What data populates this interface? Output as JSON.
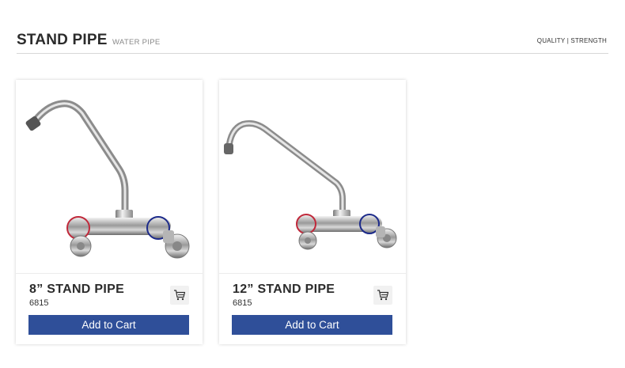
{
  "section": {
    "title": "STAND PIPE",
    "subtitle": "WATER PIPE",
    "tagline": "QUALITY | STRENGTH"
  },
  "products": [
    {
      "name": "8” STAND PIPE",
      "code": "6815",
      "add_label": "Add to Cart",
      "cart_icon": "cart-icon",
      "image": "wall-mounted-mixer-tap-high-spout"
    },
    {
      "name": "12” STAND PIPE",
      "code": "6815",
      "add_label": "Add to Cart",
      "cart_icon": "cart-icon",
      "image": "wall-mounted-mixer-tap-long-spout"
    }
  ],
  "colors": {
    "button": "#2f4f99",
    "hot_ring": "#c0283a",
    "cold_ring": "#1c2a8a"
  }
}
